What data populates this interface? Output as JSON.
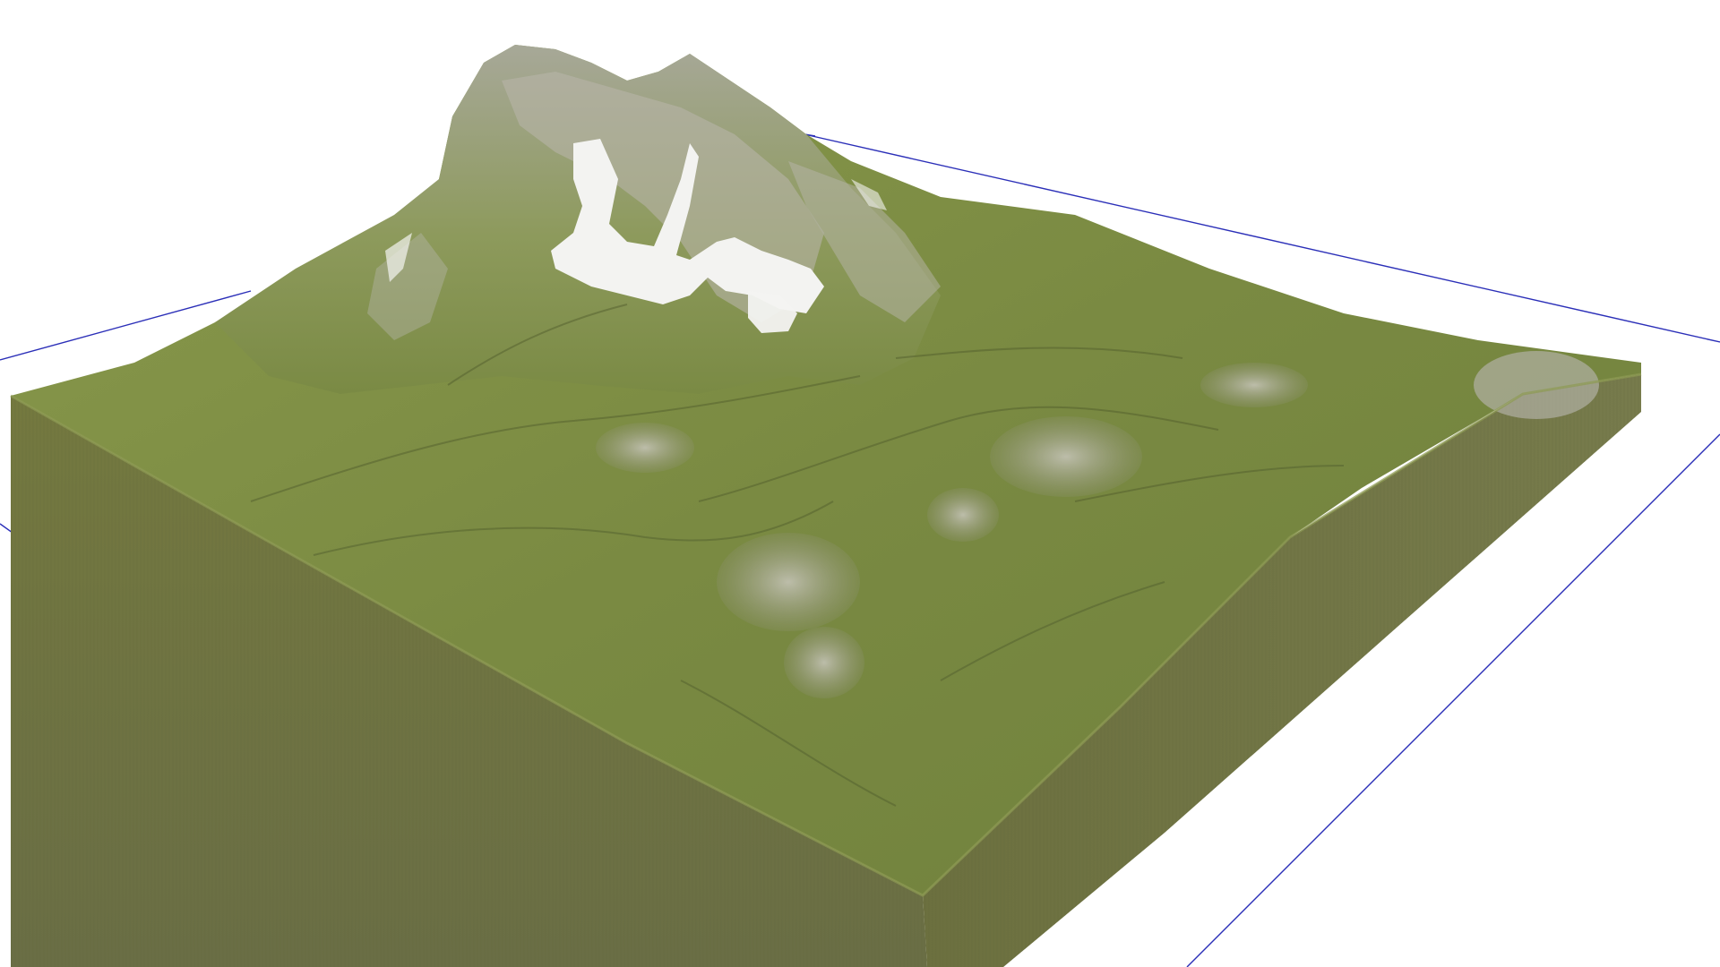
{
  "viewport": {
    "background_color": "#ffffff",
    "bounding_box_color": "#2b2fb8",
    "terrain_colors": {
      "grass": "#7a8a44",
      "grass_light": "#8f9d52",
      "grass_dark": "#5a6a30",
      "side_wall": "#6e7245",
      "side_wall_dark": "#5f633b",
      "rock": "#b9b6ab",
      "rock_dark": "#8e8b82",
      "snow": "#f2f2f0"
    },
    "scene_description": "terrain-block"
  }
}
